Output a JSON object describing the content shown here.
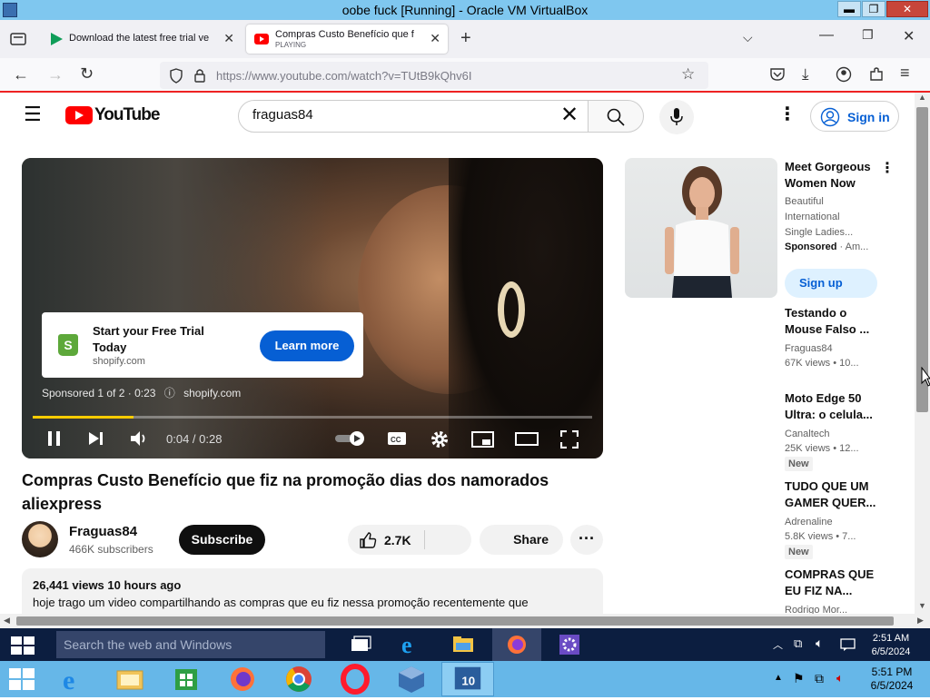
{
  "vm_window": {
    "title": "oobe fuck [Running] - Oracle VM VirtualBox",
    "minimize": "▬",
    "maximize": "❐",
    "close": "✕"
  },
  "browser": {
    "tabs": [
      {
        "label": "Download the latest free trial ve",
        "sub": ""
      },
      {
        "label": "Compras Custo Benefício que f",
        "sub": "PLAYING"
      }
    ],
    "url": "https://www.youtube.com/watch?v=TUtB9kQhv6I"
  },
  "youtube": {
    "logo_text": "YouTube",
    "search_value": "fraguas84",
    "signin_label": "Sign in",
    "player": {
      "ad_headline": "Start your Free Trial Today",
      "ad_domain": "shopify.com",
      "ad_cta": "Learn more",
      "sponsored_meta": "Sponsored 1 of 2 · 0:23",
      "sponsored_domain": "shopify.com",
      "time": "0:04 / 0:28",
      "progress_fraction": 0.18
    },
    "video_title": "Compras Custo Benefício que fiz na promoção dias dos namorados aliexpress",
    "channel": {
      "name": "Fraguas84",
      "subscribers": "466K subscribers"
    },
    "subscribe_label": "Subscribe",
    "likes": "2.7K",
    "share_label": "Share",
    "description": {
      "stats": "26,441 views  10 hours ago",
      "text": "hoje trago um video compartilhando as compras que eu fiz nessa promoção recentemente que"
    },
    "sidebar": {
      "ad": {
        "title": "Meet Gorgeous Women Now",
        "desc": "Beautiful International Single Ladies...",
        "sponsored": "Sponsored",
        "advertiser": " · Am...",
        "cta": "Sign up"
      },
      "videos": [
        {
          "title": "Testando o Mouse Falso ...",
          "channel": "Fraguas84",
          "meta": "67K views • 10...",
          "badge": ""
        },
        {
          "title": "Moto Edge 50 Ultra: o celula...",
          "channel": "Canaltech",
          "meta": "25K views • 12...",
          "badge": "New"
        },
        {
          "title": "TUDO QUE UM GAMER QUER...",
          "channel": "Adrenaline",
          "meta": "5.8K views • 7...",
          "badge": "New"
        },
        {
          "title": "COMPRAS QUE EU FIZ NA...",
          "channel": "Rodrigo Mor...",
          "meta": "",
          "badge": ""
        }
      ]
    }
  },
  "guest_taskbar": {
    "search_placeholder": "Search the web and Windows",
    "time": "2:51 AM",
    "date": "6/5/2024"
  },
  "host_taskbar": {
    "time": "5:51 PM",
    "date": "6/5/2024"
  },
  "colors": {
    "youtube_red": "#ff0000",
    "link_blue": "#065fd4",
    "progress_yellow": "#ffcc00",
    "vm_titlebar": "#7fc7ef",
    "guest_taskbar": "#0c1e40",
    "host_taskbar": "#66b7e8"
  }
}
